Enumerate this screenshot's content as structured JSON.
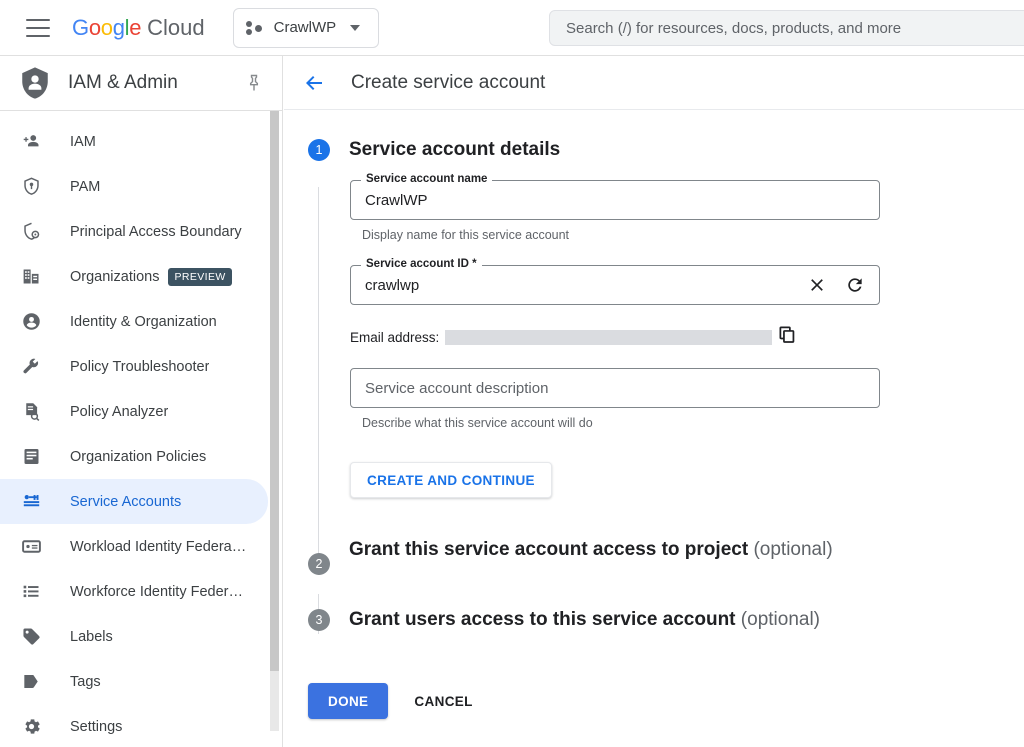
{
  "topbar": {
    "menu_icon": "hamburger-menu-icon",
    "logo": {
      "google": "Google",
      "cloud": "Cloud"
    },
    "project": {
      "name": "CrawlWP",
      "icon": "project-dots-icon",
      "caret": "chevron-down-icon"
    },
    "search": {
      "placeholder": "Search (/) for resources, docs, products, and more"
    }
  },
  "sidebar": {
    "title": "IAM & Admin",
    "title_icon": "shield-person-icon",
    "pin_icon": "pin-icon",
    "items": [
      {
        "label": "IAM",
        "icon": "person-add-icon",
        "active": false
      },
      {
        "label": "PAM",
        "icon": "shield-key-icon",
        "active": false
      },
      {
        "label": "Principal Access Boundary",
        "icon": "shield-boundary-icon",
        "active": false
      },
      {
        "label": "Organizations",
        "icon": "organization-icon",
        "active": false,
        "badge": "PREVIEW"
      },
      {
        "label": "Identity & Organization",
        "icon": "account-circle-icon",
        "active": false
      },
      {
        "label": "Policy Troubleshooter",
        "icon": "wrench-icon",
        "active": false
      },
      {
        "label": "Policy Analyzer",
        "icon": "document-search-icon",
        "active": false
      },
      {
        "label": "Organization Policies",
        "icon": "policy-document-icon",
        "active": false
      },
      {
        "label": "Service Accounts",
        "icon": "key-badge-icon",
        "active": true
      },
      {
        "label": "Workload Identity Federat…",
        "icon": "id-card-icon",
        "active": false
      },
      {
        "label": "Workforce Identity Federa…",
        "icon": "list-icon",
        "active": false
      },
      {
        "label": "Labels",
        "icon": "label-tag-icon",
        "active": false
      },
      {
        "label": "Tags",
        "icon": "tag-icon",
        "active": false
      },
      {
        "label": "Settings",
        "icon": "gear-icon",
        "active": false
      }
    ]
  },
  "main": {
    "back_icon": "back-arrow-icon",
    "title": "Create service account",
    "steps": [
      {
        "number": "1",
        "title": "Service account details",
        "optional": "",
        "state": "active"
      },
      {
        "number": "2",
        "title": "Grant this service account access to project",
        "optional": "(optional)",
        "state": "pending"
      },
      {
        "number": "3",
        "title": "Grant users access to this service account",
        "optional": "(optional)",
        "state": "pending"
      }
    ],
    "fields": {
      "name": {
        "label": "Service account name",
        "value": "CrawlWP",
        "helper": "Display name for this service account"
      },
      "id": {
        "label": "Service account ID *",
        "value": "crawlwp",
        "clear_icon": "close-icon",
        "refresh_icon": "refresh-icon"
      },
      "email": {
        "label": "Email address:",
        "value": "",
        "copy_icon": "copy-icon"
      },
      "description": {
        "placeholder": "Service account description",
        "value": "",
        "helper": "Describe what this service account will do"
      }
    },
    "buttons": {
      "create_continue": "CREATE AND CONTINUE",
      "done": "DONE",
      "cancel": "CANCEL"
    }
  },
  "colors": {
    "accent_blue": "#1a73e8",
    "active_nav_bg": "#e8f0fe",
    "active_nav_text": "#1967d2",
    "preview_badge_bg": "#3c5362",
    "pending_step": "#80868b",
    "done_button": "#3b72e0"
  }
}
